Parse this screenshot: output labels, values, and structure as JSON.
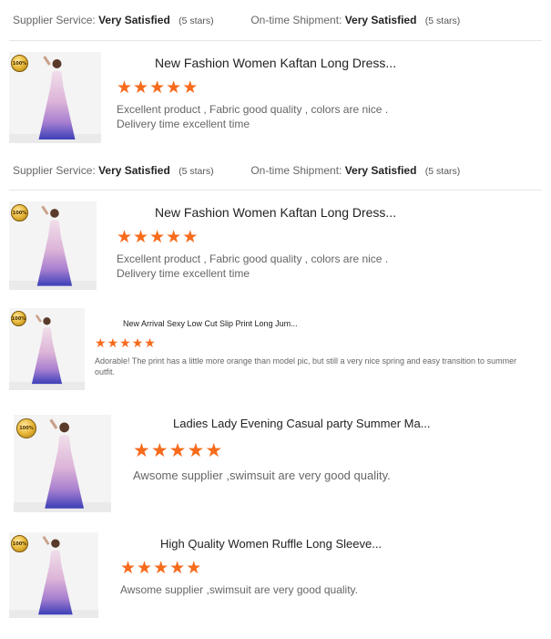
{
  "ratings": {
    "supplier_label": "Supplier Service:",
    "supplier_value": "Very Satisfied",
    "supplier_stars": "(5 stars)",
    "shipment_label": "On-time Shipment:",
    "shipment_value": "Very Satisfied",
    "shipment_stars": "(5 stars)"
  },
  "badge_text": "100%",
  "star_glyph": "★",
  "accent_color": "#f76b1c",
  "reviews": [
    {
      "title": "New Fashion Women Kaftan Long Dress...",
      "rating": 5,
      "text": "Excellent product , Fabric good quality , colors are nice . Delivery time excellent time"
    },
    {
      "title": "New Fashion Women Kaftan Long Dress...",
      "rating": 5,
      "text": "Excellent product , Fabric good quality , colors are nice . Delivery time excellent time"
    },
    {
      "title": "New Arrival Sexy Low Cut Slip Print Long Jum...",
      "rating": 5,
      "text": "Adorable! The print has a little more orange than model pic, but still a very nice spring and easy transition to summer outfit."
    },
    {
      "title": "Ladies Lady Evening Casual party Summer Ma...",
      "rating": 5,
      "text": "Awsome supplier ,swimsuit are very good quality."
    },
    {
      "title": "High Quality Women Ruffle Long Sleeve...",
      "rating": 5,
      "text": "Awsome supplier ,swimsuit are very good quality."
    }
  ]
}
